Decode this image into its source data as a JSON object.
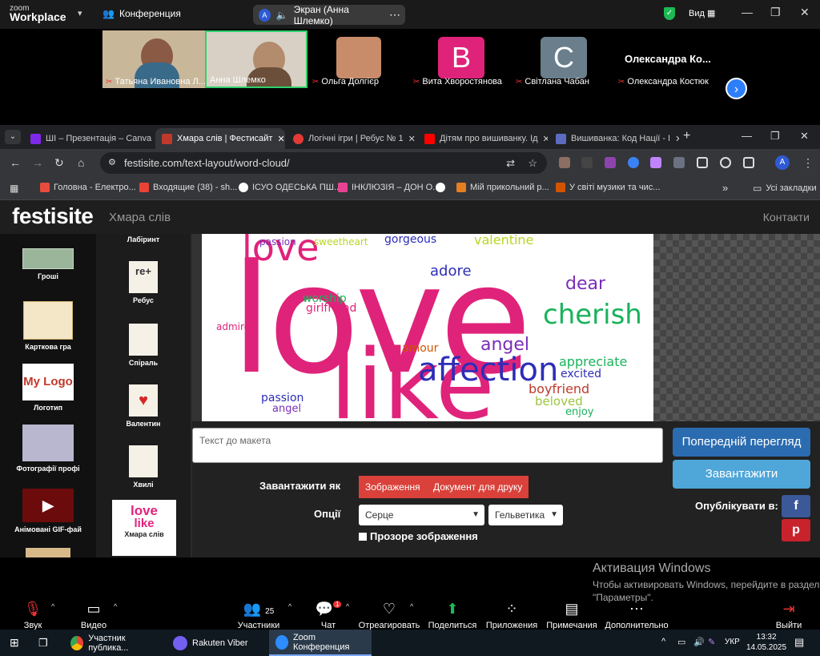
{
  "zoom": {
    "logo_small": "zoom",
    "logo_big": "Workplace",
    "conference": "Конференция",
    "screen_share": "Экран (Анна Шлемко)",
    "avatar_letter": "A",
    "view": "Вид",
    "participants": [
      {
        "name": "Татьяна Ивановна Л..."
      },
      {
        "name": "Анна Шлемко"
      },
      {
        "name": "Ольга Долгієр"
      },
      {
        "name": "Вита Хворостянова",
        "letter": "В"
      },
      {
        "name": "Світлана Чабан",
        "letter": "С"
      },
      {
        "name": "Олександра  Костюк",
        "title": "Олександра    Ко..."
      }
    ],
    "controls": {
      "audio": "Звук",
      "video": "Видео",
      "participants": "Участники",
      "participants_count": "25",
      "chat": "Чат",
      "chat_badge": "1",
      "react": "Отреагировать",
      "share": "Поделиться",
      "apps": "Приложения",
      "notes": "Примечания",
      "more": "Дополнительно",
      "leave": "Выйти"
    },
    "activation_title": "Активация Windows",
    "activation_text": "Чтобы активировать Windows, перейдите в раздел \"Параметры\"."
  },
  "browser": {
    "tabs": [
      {
        "label": "ШІ – Презентація – Canva",
        "color": "#7d2ae8"
      },
      {
        "label": "Хмара слів | Фестисайт",
        "color": "#c0392b"
      },
      {
        "label": "Логічні ігри | Ребус № 1",
        "color": "#e53935"
      },
      {
        "label": "Дітям про вишиванку. Ід",
        "color": "#ff0000"
      },
      {
        "label": "Вишиванка: Код Нації - І",
        "color": "#5c6bc0"
      }
    ],
    "url": "festisite.com/text-layout/word-cloud/",
    "profile_letter": "A",
    "bookmarks": [
      "Головна - Електро...",
      "Входящие (38) - sh...",
      "ІСУО ОДЕСЬКА ПШ...",
      "ІНКЛЮЗІЯ – ДОН О...",
      "",
      "Мій прикольний р...",
      "У світі музики та чис..."
    ],
    "all_bookmarks": "Усі закладки"
  },
  "site": {
    "logo": "festisite",
    "title": "Хмара слів",
    "contact": "Контакти",
    "col1": [
      "Гроші",
      "Карткова гра",
      "Логотип",
      "Фотографії профі",
      "Анімовані GIF-фай"
    ],
    "col2": [
      "Лабіринт",
      "Ребус",
      "Спіраль",
      "Валентин",
      "Хвилі",
      "Хмара слів"
    ],
    "textarea_placeholder": "Текст до макета",
    "preview_btn": "Попередній перегляд",
    "download_btn": "Завантажити",
    "download_as": "Завантажити як",
    "format_image": "Зображення",
    "format_print": "Документ для друку",
    "options": "Опції",
    "shape": "Серце",
    "font": "Гельветика",
    "transparent": "Прозоре зображення",
    "publish": "Опублікувати в:",
    "mylogo": "My Logo",
    "rebus_text": "re+",
    "love_thumb": "love",
    "like_thumb": "like"
  },
  "cloud_words": {
    "love": "love",
    "like": "like",
    "appreciate": "appreciate",
    "affection": "affection",
    "cherish": "cherish",
    "dear": "dear",
    "angel": "angel",
    "adore": "adore",
    "passion": "passion",
    "valentine": "valentine",
    "girlfriend": "girlfriend",
    "boyfriend": "boyfriend",
    "worship": "worship",
    "gorgeous": "gorgeous",
    "sweetheart": "sweetheart",
    "excited": "excited",
    "enjoy": "enjoy",
    "beloved": "beloved",
    "amour": "amour",
    "admire": "admire"
  },
  "taskbar": {
    "chrome": "Участник публика...",
    "viber": "Rakuten Viber",
    "zoom": "Zoom Конференция",
    "lang": "УКР",
    "time": "13:32",
    "date": "14.05.2025"
  }
}
